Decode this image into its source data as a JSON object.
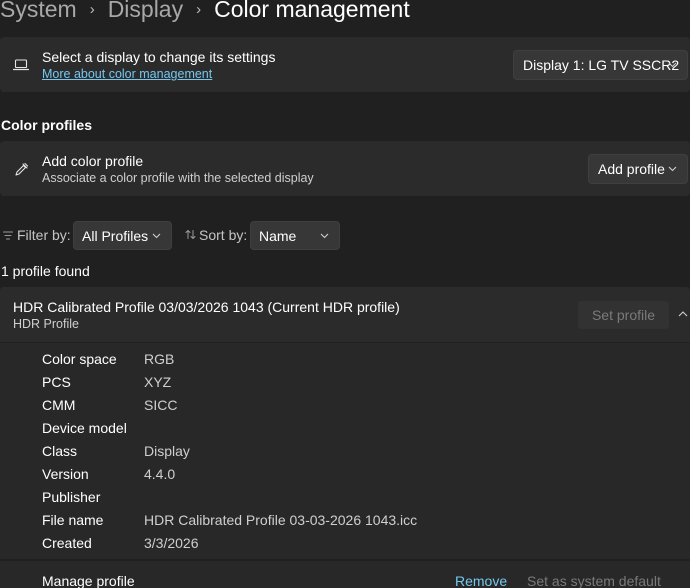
{
  "breadcrumb": {
    "items": [
      "System",
      "Display"
    ],
    "current": "Color management"
  },
  "display_card": {
    "icon": "laptop-icon",
    "title": "Select a display to change its settings",
    "link": "More about color management",
    "dropdown_value": "Display 1: LG TV SSCR2"
  },
  "color_profiles": {
    "header": "Color profiles",
    "add_card": {
      "icon": "eyedropper-icon",
      "title": "Add color profile",
      "subtitle": "Associate a color profile with the selected display",
      "button_label": "Add profile"
    },
    "filter": {
      "label": "Filter by:",
      "value": "All Profiles",
      "icon": "filter-icon"
    },
    "sort": {
      "label": "Sort by:",
      "value": "Name",
      "icon": "sort-icon"
    },
    "count_text": "1 profile found"
  },
  "profile": {
    "title": "HDR Calibrated Profile 03/03/2026 1043 (Current HDR profile)",
    "subtitle": "HDR Profile",
    "set_button": "Set profile",
    "collapse_icon": "chevron-up-icon",
    "properties": [
      {
        "label": "Color space",
        "value": "RGB"
      },
      {
        "label": "PCS",
        "value": "XYZ"
      },
      {
        "label": "CMM",
        "value": "SICC"
      },
      {
        "label": "Device model",
        "value": ""
      },
      {
        "label": "Class",
        "value": "Display"
      },
      {
        "label": "Version",
        "value": "4.4.0"
      },
      {
        "label": "Publisher",
        "value": ""
      },
      {
        "label": "File name",
        "value": "HDR Calibrated Profile 03-03-2026 1043.icc"
      },
      {
        "label": "Created",
        "value": "3/3/2026"
      }
    ],
    "manage": {
      "label": "Manage profile",
      "remove": "Remove",
      "set_default": "Set as system default"
    }
  },
  "colors": {
    "accent_link": "#75c7f0",
    "card_bg": "#2b2b2b",
    "page_bg": "#202020"
  }
}
